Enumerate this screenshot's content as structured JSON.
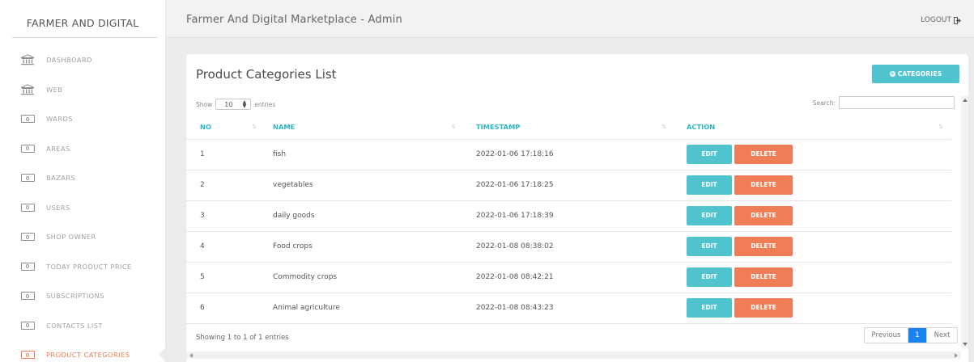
{
  "brand": "FARMER AND DIGITAL",
  "header": {
    "title": "Farmer And Digital Marketplace - Admin",
    "logout": "LOGOUT"
  },
  "sidebar": {
    "items": [
      {
        "label": "DASHBOARD",
        "icon": "bank-icon"
      },
      {
        "label": "WEB",
        "icon": "bank-icon"
      },
      {
        "label": "WARDS",
        "icon": "money-icon"
      },
      {
        "label": "AREAS",
        "icon": "money-icon"
      },
      {
        "label": "BAZARS",
        "icon": "money-icon"
      },
      {
        "label": "USERS",
        "icon": "money-icon"
      },
      {
        "label": "SHOP OWNER",
        "icon": "money-icon"
      },
      {
        "label": "TODAY PRODUCT PRICE",
        "icon": "money-icon"
      },
      {
        "label": "SUBSCRIPTIONS",
        "icon": "money-icon"
      },
      {
        "label": "CONTACTS LIST",
        "icon": "money-icon"
      },
      {
        "label": "PRODUCT CATEGORIES",
        "icon": "money-icon",
        "active": true
      }
    ]
  },
  "card": {
    "title": "Product Categories List",
    "add_button": "CATEGORIES"
  },
  "controls": {
    "show_label": "Show",
    "entries_value": "10",
    "entries_label": "entries",
    "search_label": "Search:",
    "search_value": ""
  },
  "table": {
    "columns": [
      "NO",
      "NAME",
      "TIMESTAMP",
      "ACTION"
    ],
    "rows": [
      {
        "no": "1",
        "name": "fish",
        "timestamp": "2022-01-06 17:18:16"
      },
      {
        "no": "2",
        "name": "vegetables",
        "timestamp": "2022-01-06 17:18:25"
      },
      {
        "no": "3",
        "name": "daily goods",
        "timestamp": "2022-01-06 17:18:39"
      },
      {
        "no": "4",
        "name": "Food crops",
        "timestamp": "2022-01-08 08:38:02"
      },
      {
        "no": "5",
        "name": "Commodity crops",
        "timestamp": "2022-01-08 08:42:21"
      },
      {
        "no": "6",
        "name": "Animal agriculture",
        "timestamp": "2022-01-08 08:43:23"
      }
    ],
    "edit_label": "EDIT",
    "delete_label": "DELETE"
  },
  "footer": {
    "showing": "Showing 1 to 1 of 1 entries",
    "prev": "Previous",
    "current": "1",
    "next": "Next"
  },
  "colors": {
    "accent": "#4fc4cf",
    "danger": "#f07d55",
    "header_text": "#2bb6c4",
    "active_nav": "#f07a50",
    "pager_active": "#1b83f0"
  }
}
